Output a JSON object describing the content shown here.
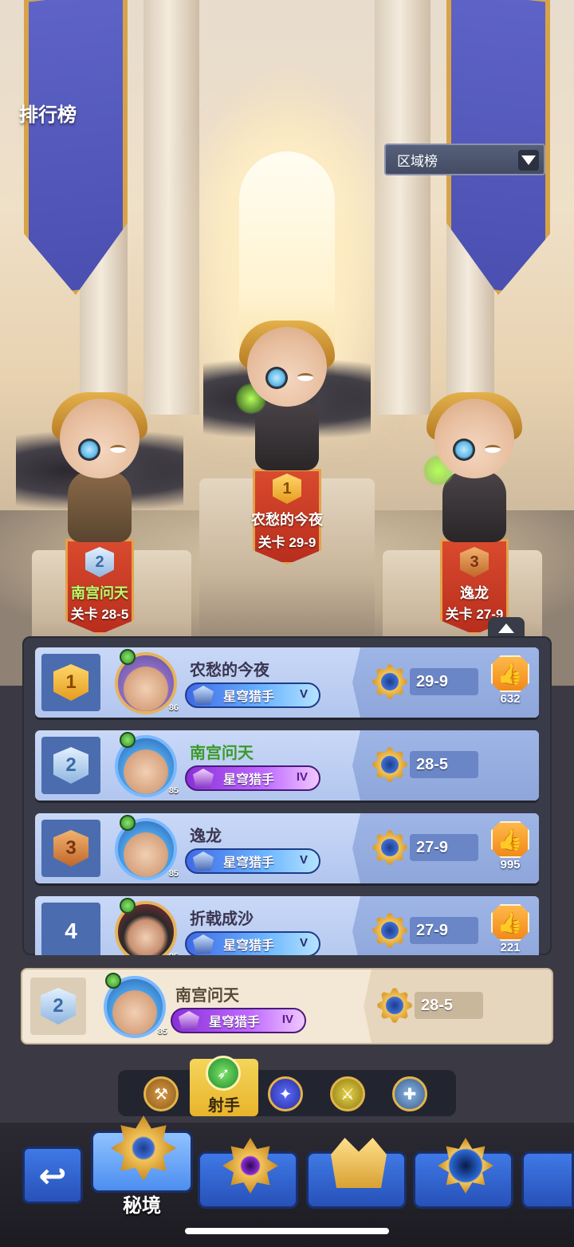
{
  "header": {
    "title": "排行榜",
    "region_dropdown": "区域榜"
  },
  "podium": [
    {
      "rank": "1",
      "name": "农愁的今夜",
      "stage": "关卡 29-9"
    },
    {
      "rank": "2",
      "name": "南宫问天",
      "stage": "关卡 28-5"
    },
    {
      "rank": "3",
      "name": "逸龙",
      "stage": "关卡 27-9"
    }
  ],
  "leaderboard": [
    {
      "rank": "1",
      "name": "农愁的今夜",
      "level": "86",
      "title": "星穹猎手",
      "tier": "V",
      "stage": "29-9",
      "likes": "632"
    },
    {
      "rank": "2",
      "name": "南宫问天",
      "level": "85",
      "title": "星穹猎手",
      "tier": "IV",
      "stage": "28-5",
      "likes": ""
    },
    {
      "rank": "3",
      "name": "逸龙",
      "level": "85",
      "title": "星穹猎手",
      "tier": "V",
      "stage": "27-9",
      "likes": "995"
    },
    {
      "rank": "4",
      "name": "折戟成沙",
      "level": "85",
      "title": "星穹猎手",
      "tier": "V",
      "stage": "27-9",
      "likes": "221"
    }
  ],
  "my_rank": {
    "rank": "2",
    "name": "南宫问天",
    "level": "85",
    "title": "星穹猎手",
    "tier": "IV",
    "stage": "28-5"
  },
  "class_filter": {
    "active_label": "射手"
  },
  "bottom_nav": {
    "back_icon": "↩",
    "active_label": "秘境"
  },
  "colors": {
    "board_bg": "#393b48",
    "row_bg": "#c9d8f7",
    "my_row_bg": "#f3e8d6",
    "like_orange": "#f08a1a",
    "nav_blue": "#2751b8"
  }
}
